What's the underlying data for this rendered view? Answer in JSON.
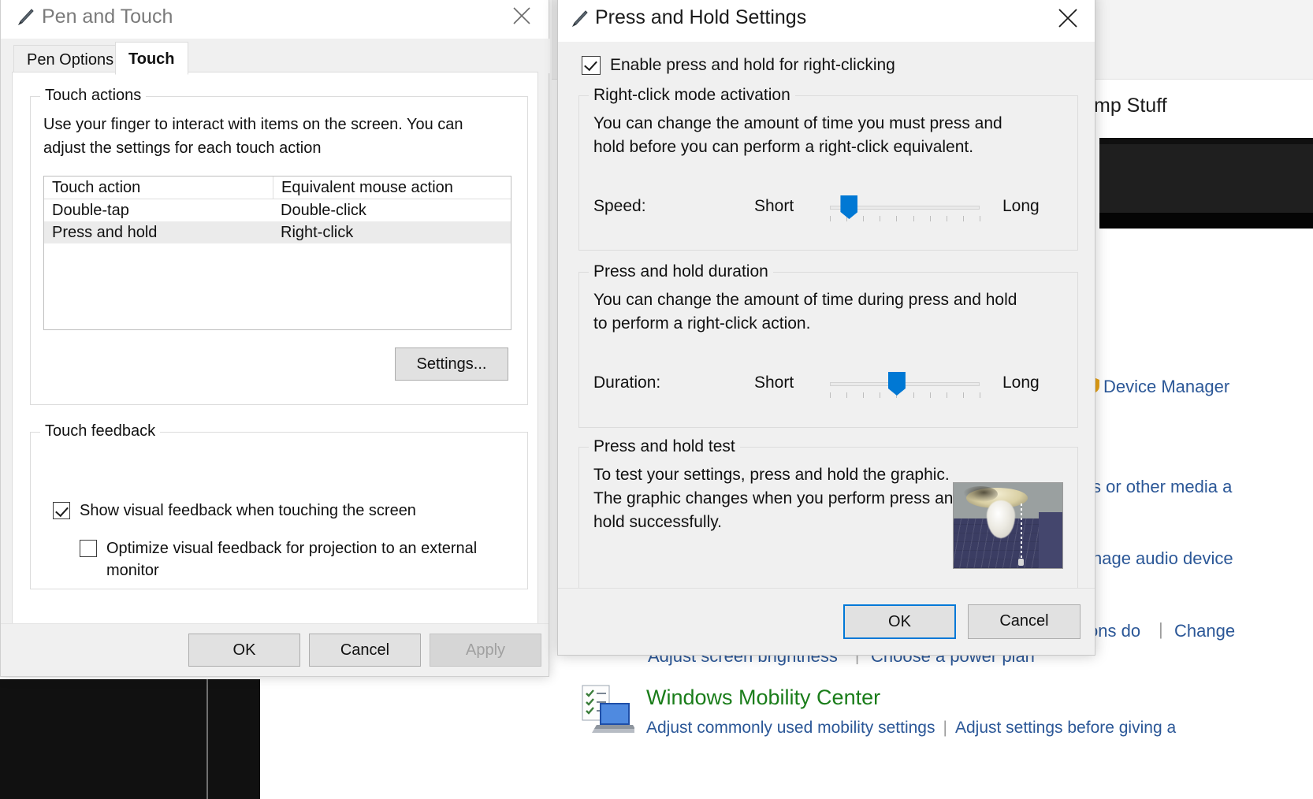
{
  "background": {
    "header_title": "mp Stuff",
    "links": {
      "device_manager": "Device Manager",
      "media": "s or other media a",
      "audio": "nage audio device",
      "ons_do": "ons do",
      "change": "Change",
      "separator": "|",
      "adjust_brightness": "Adjust screen brightness",
      "choose_power_plan": "Choose a power plan"
    },
    "mobility_center": {
      "title": "Windows Mobility Center",
      "sub_left": "Adjust commonly used mobility settings",
      "sub_right": "Adjust settings before giving a",
      "separator": "|",
      "icon": "mobility-center-icon"
    }
  },
  "pen_dialog": {
    "title": "Pen and Touch",
    "title_icon": "pen-icon",
    "close_icon": "close-icon",
    "tabs": [
      {
        "label": "Pen Options",
        "active": false
      },
      {
        "label": "Touch",
        "active": true
      }
    ],
    "touch_actions": {
      "legend": "Touch actions",
      "description": "Use your finger to interact with items on the screen. You can adjust the settings for each touch action",
      "columns": [
        "Touch action",
        "Equivalent mouse action"
      ],
      "rows": [
        {
          "action": "Double-tap",
          "mouse": "Double-click",
          "selected": false
        },
        {
          "action": "Press and hold",
          "mouse": "Right-click",
          "selected": true
        }
      ],
      "settings_button": "Settings..."
    },
    "touch_feedback": {
      "legend": "Touch feedback",
      "show_visual_feedback": {
        "label": "Show visual feedback when touching the screen",
        "checked": true
      },
      "optimize_projection": {
        "label": "Optimize visual feedback for projection to an external monitor",
        "checked": false
      }
    },
    "footer": {
      "ok": "OK",
      "cancel": "Cancel",
      "apply": "Apply",
      "apply_disabled": true
    }
  },
  "press_hold_dialog": {
    "title": "Press and Hold Settings",
    "title_icon": "pen-icon",
    "close_icon": "close-icon",
    "enable_checkbox": {
      "label": "Enable press and hold for right-clicking",
      "checked": true
    },
    "activation": {
      "legend": "Right-click mode activation",
      "description": "You can change the amount of time you must press and hold before you can perform a right-click equivalent.",
      "slider_label": "Speed:",
      "min_label": "Short",
      "max_label": "Long",
      "value_percent": 8,
      "tick_count": 10
    },
    "duration": {
      "legend": "Press and hold duration",
      "description": "You can change the amount of time during press and hold to perform a right-click action.",
      "slider_label": "Duration:",
      "min_label": "Short",
      "max_label": "Long",
      "value_percent": 44,
      "tick_count": 10
    },
    "test": {
      "legend": "Press and hold test",
      "description": "To test your settings, press and hold the graphic. The graphic changes when you perform press and hold successfully.",
      "graphic_name": "lamp-test-graphic"
    },
    "footer": {
      "ok": "OK",
      "cancel": "Cancel",
      "ok_focused": true
    }
  },
  "colors": {
    "accent": "#0078d4",
    "link": "#2b5797",
    "green": "#1a7d1a",
    "dialog_bg": "#f0f0f0"
  }
}
